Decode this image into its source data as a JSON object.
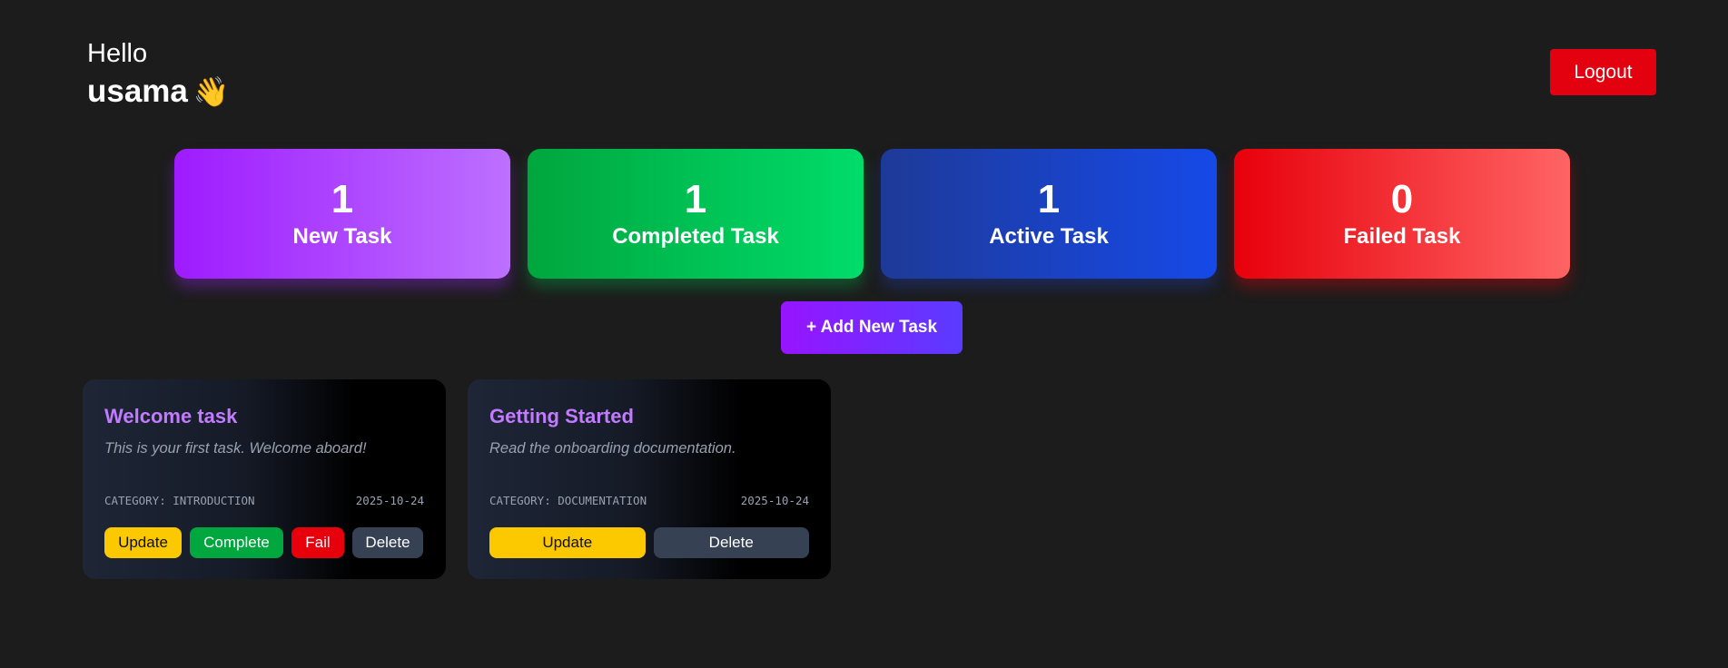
{
  "header": {
    "hello": "Hello",
    "username": "usama",
    "wave_emoji": "👋",
    "logout_label": "Logout"
  },
  "stats": [
    {
      "count": "1",
      "label": "New Task",
      "color": "#b06bff"
    },
    {
      "count": "1",
      "label": "Completed Task",
      "color": "#00c853"
    },
    {
      "count": "1",
      "label": "Active Task",
      "color": "#1f46d8"
    },
    {
      "count": "0",
      "label": "Failed Task",
      "color": "#f0202c"
    }
  ],
  "add_task_label": "+ Add New Task",
  "tasks": [
    {
      "title": "Welcome task",
      "description": "This is your first task. Welcome aboard!",
      "category": "CATEGORY: INTRODUCTION",
      "date": "2025-10-24",
      "buttons": {
        "update": "Update",
        "complete": "Complete",
        "fail": "Fail",
        "delete": "Delete"
      }
    },
    {
      "title": "Getting Started",
      "description": "Read the onboarding documentation.",
      "category": "CATEGORY: DOCUMENTATION",
      "date": "2025-10-24",
      "buttons": {
        "update": "Update",
        "delete": "Delete"
      }
    }
  ],
  "colors": {
    "background": "#1c1c1c",
    "task_title": "#c27aff",
    "logout": "#e3000f",
    "update": "#fcc800",
    "complete": "#00a63e",
    "fail": "#e7000b",
    "delete": "#364153"
  }
}
